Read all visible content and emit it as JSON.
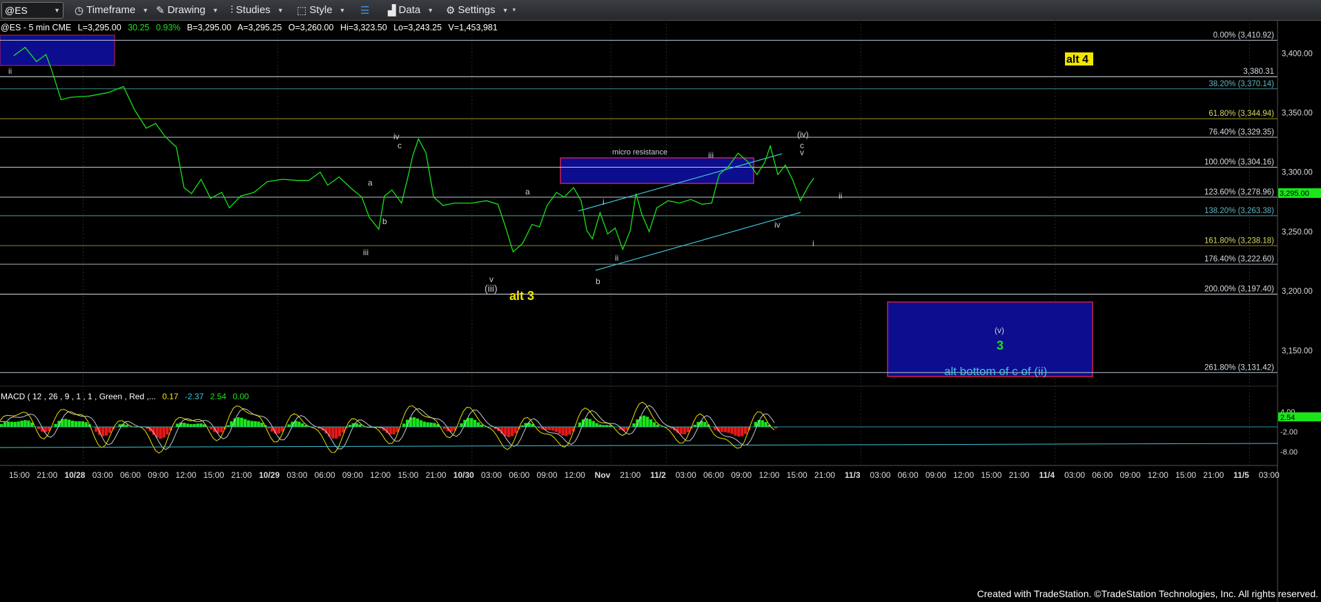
{
  "toolbar": {
    "symbol": "@ES",
    "items": [
      "Timeframe",
      "Drawing",
      "Studies",
      "Style",
      "Data",
      "Settings"
    ]
  },
  "header": {
    "symbol_line": "@ES - 5 min  CME",
    "last": "L=3,295.00",
    "change": "30.25",
    "pct": "0.93%",
    "bid": "B=3,295.00",
    "ask": "A=3,295.25",
    "open": "O=3,260.00",
    "hi": "Hi=3,323.50",
    "lo": "Lo=3,243.25",
    "vol": "V=1,453,981"
  },
  "colors": {
    "price_line": "#19e619",
    "fib_line": "#8fb4c8",
    "box_fill": "#0d0d8f",
    "box_border": "#d02050",
    "label_yellow": "#f2e600",
    "macd_up": "#19e619",
    "macd_down": "#e61919",
    "cyan": "#3ec6d8"
  },
  "fib_levels": [
    {
      "label": "0.00% (3,410.92)",
      "value": 3410.92,
      "color": "#a8b4c0"
    },
    {
      "label": "3,380.31",
      "value": 3380.31,
      "color": "#c8d0d8"
    },
    {
      "label": "38.20% (3,370.14)",
      "value": 3370.14,
      "color": "#3e8f96"
    },
    {
      "label": "61.80% (3,344.94)",
      "value": 3344.94,
      "color": "#8a8a1e"
    },
    {
      "label": "76.40% (3,329.35)",
      "value": 3329.35,
      "color": "#a8b4c0"
    },
    {
      "label": "100.00% (3,304.16)",
      "value": 3304.16,
      "color": "#c8d0d8"
    },
    {
      "label": "123.60% (3,278.96)",
      "value": 3278.96,
      "color": "#a8b4c0"
    },
    {
      "label": "138.20% (3,263.38)",
      "value": 3263.38,
      "color": "#3e8f96"
    },
    {
      "label": "161.80% (3,238.18)",
      "value": 3238.18,
      "color": "#8a8a1e"
    },
    {
      "label": "176.40% (3,222.60)",
      "value": 3222.6,
      "color": "#a8b4c0"
    },
    {
      "label": "200.00% (3,197.40)",
      "value": 3197.4,
      "color": "#c8d0d8"
    },
    {
      "label": "261.80% (3,131.42)",
      "value": 3131.42,
      "color": "#a8b4c0"
    }
  ],
  "chart_data": {
    "type": "line",
    "title": "@ES - 5 min CME",
    "y_ticks": [
      3400,
      3350,
      3300,
      3250,
      3200,
      3150
    ],
    "y_tick_labels": [
      "3,400.00",
      "3,350.00",
      "3,300.00",
      "3,250.00",
      "3,200.00",
      "3,150.00"
    ],
    "ylim": [
      3120,
      3428
    ],
    "last_price_label": "3,295.00",
    "x_tick_labels": [
      "15:00",
      "21:00",
      "10/28",
      "03:00",
      "06:00",
      "09:00",
      "12:00",
      "15:00",
      "21:00",
      "10/29",
      "03:00",
      "06:00",
      "09:00",
      "12:00",
      "15:00",
      "21:00",
      "10/30",
      "03:00",
      "06:00",
      "09:00",
      "12:00",
      "Nov",
      "21:00",
      "11/2",
      "03:00",
      "06:00",
      "09:00",
      "12:00",
      "15:00",
      "21:00",
      "11/3",
      "03:00",
      "06:00",
      "09:00",
      "12:00",
      "15:00",
      "21:00",
      "11/4",
      "03:00",
      "06:00",
      "09:00",
      "12:00",
      "15:00",
      "21:00",
      "11/5",
      "03:00"
    ],
    "x_tick_bold": [
      false,
      false,
      true,
      false,
      false,
      false,
      false,
      false,
      false,
      true,
      false,
      false,
      false,
      false,
      false,
      false,
      true,
      false,
      false,
      false,
      false,
      true,
      false,
      true,
      false,
      false,
      false,
      false,
      false,
      false,
      true,
      false,
      false,
      false,
      false,
      false,
      false,
      true,
      false,
      false,
      false,
      false,
      false,
      false,
      true,
      false
    ],
    "x_day_labels": [
      "10/28",
      "10/29",
      "10/30",
      "Nov",
      "11/2",
      "11/3",
      "11/4",
      "11/5"
    ],
    "price_path": [
      {
        "t": 0.0,
        "p": 3398
      },
      {
        "t": 0.6,
        "p": 3405
      },
      {
        "t": 1.2,
        "p": 3393
      },
      {
        "t": 1.7,
        "p": 3399
      },
      {
        "t": 2.0,
        "p": 3386
      },
      {
        "t": 2.5,
        "p": 3361
      },
      {
        "t": 3.0,
        "p": 3363
      },
      {
        "t": 4.0,
        "p": 3364
      },
      {
        "t": 5.0,
        "p": 3367
      },
      {
        "t": 5.8,
        "p": 3372
      },
      {
        "t": 6.4,
        "p": 3352
      },
      {
        "t": 7.0,
        "p": 3337
      },
      {
        "t": 7.5,
        "p": 3341
      },
      {
        "t": 8.0,
        "p": 3330
      },
      {
        "t": 8.6,
        "p": 3321
      },
      {
        "t": 9.0,
        "p": 3287
      },
      {
        "t": 9.4,
        "p": 3282
      },
      {
        "t": 9.9,
        "p": 3294
      },
      {
        "t": 10.4,
        "p": 3278
      },
      {
        "t": 11.0,
        "p": 3283
      },
      {
        "t": 11.4,
        "p": 3270
      },
      {
        "t": 12.0,
        "p": 3280
      },
      {
        "t": 12.7,
        "p": 3283
      },
      {
        "t": 13.4,
        "p": 3292
      },
      {
        "t": 14.2,
        "p": 3294
      },
      {
        "t": 15.0,
        "p": 3293
      },
      {
        "t": 15.6,
        "p": 3293
      },
      {
        "t": 16.2,
        "p": 3300
      },
      {
        "t": 16.6,
        "p": 3289
      },
      {
        "t": 17.2,
        "p": 3296
      },
      {
        "t": 17.8,
        "p": 3287
      },
      {
        "t": 18.4,
        "p": 3279
      },
      {
        "t": 18.8,
        "p": 3262
      },
      {
        "t": 19.3,
        "p": 3252
      },
      {
        "t": 19.6,
        "p": 3280
      },
      {
        "t": 20.0,
        "p": 3285
      },
      {
        "t": 20.5,
        "p": 3274
      },
      {
        "t": 20.8,
        "p": 3293
      },
      {
        "t": 21.1,
        "p": 3314
      },
      {
        "t": 21.4,
        "p": 3328
      },
      {
        "t": 21.8,
        "p": 3316
      },
      {
        "t": 22.2,
        "p": 3279
      },
      {
        "t": 22.7,
        "p": 3272
      },
      {
        "t": 23.3,
        "p": 3274
      },
      {
        "t": 24.2,
        "p": 3274
      },
      {
        "t": 25.0,
        "p": 3276
      },
      {
        "t": 25.6,
        "p": 3273
      },
      {
        "t": 26.0,
        "p": 3254
      },
      {
        "t": 26.4,
        "p": 3233
      },
      {
        "t": 26.9,
        "p": 3240
      },
      {
        "t": 27.4,
        "p": 3256
      },
      {
        "t": 27.8,
        "p": 3254
      },
      {
        "t": 28.2,
        "p": 3272
      },
      {
        "t": 28.7,
        "p": 3283
      },
      {
        "t": 29.1,
        "p": 3279
      },
      {
        "t": 29.6,
        "p": 3287
      },
      {
        "t": 30.0,
        "p": 3276
      },
      {
        "t": 30.3,
        "p": 3251
      },
      {
        "t": 30.6,
        "p": 3244
      },
      {
        "t": 31.0,
        "p": 3266
      },
      {
        "t": 31.4,
        "p": 3248
      },
      {
        "t": 31.8,
        "p": 3253
      },
      {
        "t": 32.2,
        "p": 3235
      },
      {
        "t": 32.6,
        "p": 3251
      },
      {
        "t": 32.9,
        "p": 3282
      },
      {
        "t": 33.2,
        "p": 3265
      },
      {
        "t": 33.6,
        "p": 3250
      },
      {
        "t": 34.0,
        "p": 3270
      },
      {
        "t": 34.6,
        "p": 3276
      },
      {
        "t": 35.2,
        "p": 3274
      },
      {
        "t": 35.8,
        "p": 3277
      },
      {
        "t": 36.4,
        "p": 3273
      },
      {
        "t": 36.9,
        "p": 3274
      },
      {
        "t": 37.3,
        "p": 3298
      },
      {
        "t": 37.8,
        "p": 3305
      },
      {
        "t": 38.3,
        "p": 3316
      },
      {
        "t": 38.8,
        "p": 3309
      },
      {
        "t": 39.3,
        "p": 3298
      },
      {
        "t": 39.7,
        "p": 3308
      },
      {
        "t": 40.0,
        "p": 3322
      },
      {
        "t": 40.4,
        "p": 3298
      },
      {
        "t": 40.8,
        "p": 3306
      },
      {
        "t": 41.2,
        "p": 3293
      },
      {
        "t": 41.6,
        "p": 3276
      },
      {
        "t": 42.0,
        "p": 3288
      },
      {
        "t": 42.3,
        "p": 3295
      }
    ],
    "macd": {
      "label": "MACD ( 12 , 26 , 9 , 1 , 1 , Green , Red ,...",
      "v1": "0.17",
      "v2": "-2.37",
      "v3": "2.54",
      "v4": "0.00",
      "y_ticks": [
        "4.00",
        "-2.00",
        "-8.00"
      ],
      "last_label": "2.54"
    }
  },
  "annotations": {
    "wave_ii_left": "ii",
    "iv_top": "iv",
    "c_top": "c",
    "a_left": "a",
    "b_left": "b",
    "iii_left": "iii",
    "a_mid": "a",
    "v_bottom": "v",
    "iii_paren": "(iii)",
    "alt3": "alt 3",
    "i_mid": "i",
    "ii_mid": "ii",
    "b_mid": "b",
    "micro_resistance": "micro resistance",
    "iii_right": "iii",
    "iv_paren": "(iv)",
    "c_right": "c",
    "v_right": "v",
    "iv_right": "iv",
    "ii_right": "ii",
    "i_right": "i",
    "alt4": "alt 4",
    "v_paren": "(v)",
    "three": "3",
    "alt_bottom": "alt bottom of c of (ii)"
  },
  "footer": "Created with TradeStation. ©TradeStation Technologies, Inc. All rights reserved."
}
